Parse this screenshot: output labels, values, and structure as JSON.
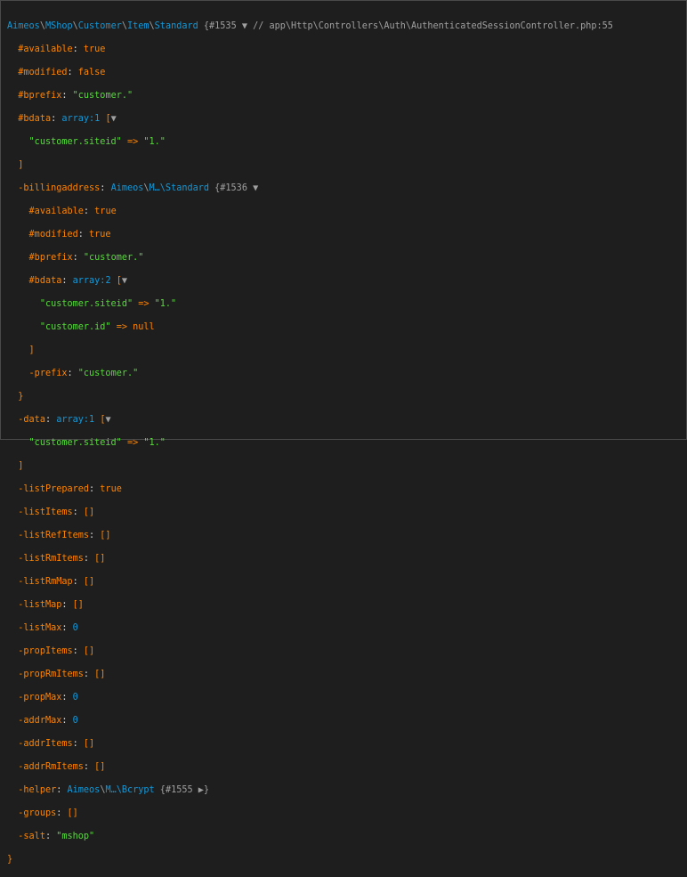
{
  "header": {
    "cls_p1": "Aimeos",
    "cls_s1": "\\",
    "cls_p2": "MShop",
    "cls_s2": "\\",
    "cls_p3": "Customer",
    "cls_s3": "\\",
    "cls_p4": "Item",
    "cls_s4": "\\",
    "cls_p5": "Standard",
    "brace": "{",
    "ref": "#1535",
    "toggle": "▼",
    "comment": "// app\\Http\\Controllers\\Auth\\AuthenticatedSessionController.php:55"
  },
  "props": {
    "available": {
      "key": "#available",
      "val": "true"
    },
    "modified": {
      "key": "#modified",
      "val": "false"
    },
    "bprefix": {
      "key": "#bprefix",
      "val": "\"customer.\""
    },
    "bdata": {
      "key": "#bdata",
      "type": "array:1",
      "bracket": "[",
      "toggle": "▼",
      "entries": [
        {
          "k": "\"customer.siteid\"",
          "arrow": "=>",
          "v": "\"1.\""
        }
      ],
      "close": "]"
    },
    "billing": {
      "key": "-billingaddress",
      "cls_a": "Aimeos",
      "cls_s": "\\",
      "cls_b": "M…\\Standard",
      "brace": "{",
      "ref": "#1536",
      "toggle": "▼",
      "available": {
        "key": "#available",
        "val": "true"
      },
      "modified": {
        "key": "#modified",
        "val": "true"
      },
      "bprefix": {
        "key": "#bprefix",
        "val": "\"customer.\""
      },
      "bdata": {
        "key": "#bdata",
        "type": "array:2",
        "bracket": "[",
        "toggle": "▼",
        "e1": {
          "k": "\"customer.siteid\"",
          "arrow": "=>",
          "v": "\"1.\""
        },
        "e2": {
          "k": "\"customer.id\"",
          "arrow": "=>",
          "v": "null"
        },
        "close": "]"
      },
      "prefix": {
        "key": "-prefix",
        "val": "\"customer.\""
      },
      "close": "}"
    },
    "data": {
      "key": "-data",
      "type": "array:1",
      "bracket": "[",
      "toggle": "▼",
      "entry": {
        "k": "\"customer.siteid\"",
        "arrow": "=>",
        "v": "\"1.\""
      },
      "close": "]"
    },
    "listPrepared": {
      "key": "-listPrepared",
      "val": "true"
    },
    "listItems": {
      "key": "-listItems",
      "val": "[]"
    },
    "listRefItems": {
      "key": "-listRefItems",
      "val": "[]"
    },
    "listRmItems": {
      "key": "-listRmItems",
      "val": "[]"
    },
    "listRmMap": {
      "key": "-listRmMap",
      "val": "[]"
    },
    "listMap": {
      "key": "-listMap",
      "val": "[]"
    },
    "listMax": {
      "key": "-listMax",
      "val": "0"
    },
    "propItems": {
      "key": "-propItems",
      "val": "[]"
    },
    "propRmItems": {
      "key": "-propRmItems",
      "val": "[]"
    },
    "propMax": {
      "key": "-propMax",
      "val": "0"
    },
    "addrMax": {
      "key": "-addrMax",
      "val": "0"
    },
    "addrItems": {
      "key": "-addrItems",
      "val": "[]"
    },
    "addrRmItems": {
      "key": "-addrRmItems",
      "val": "[]"
    },
    "helper": {
      "key": "-helper",
      "cls_a": "Aimeos",
      "cls_s": "\\",
      "cls_b": "M…\\Bcrypt",
      "brace": "{",
      "ref": "#1555",
      "toggle": "▶",
      "close": "}"
    },
    "groups": {
      "key": "-groups",
      "val": "[]"
    },
    "salt": {
      "key": "-salt",
      "val": "\"mshop\""
    }
  },
  "footer": {
    "close": "}"
  },
  "colors": {
    "background": "#1e1e1e",
    "key": "#ff8400",
    "string": "#56db3a",
    "class": "#1299da",
    "meta": "#a0a0a0"
  }
}
